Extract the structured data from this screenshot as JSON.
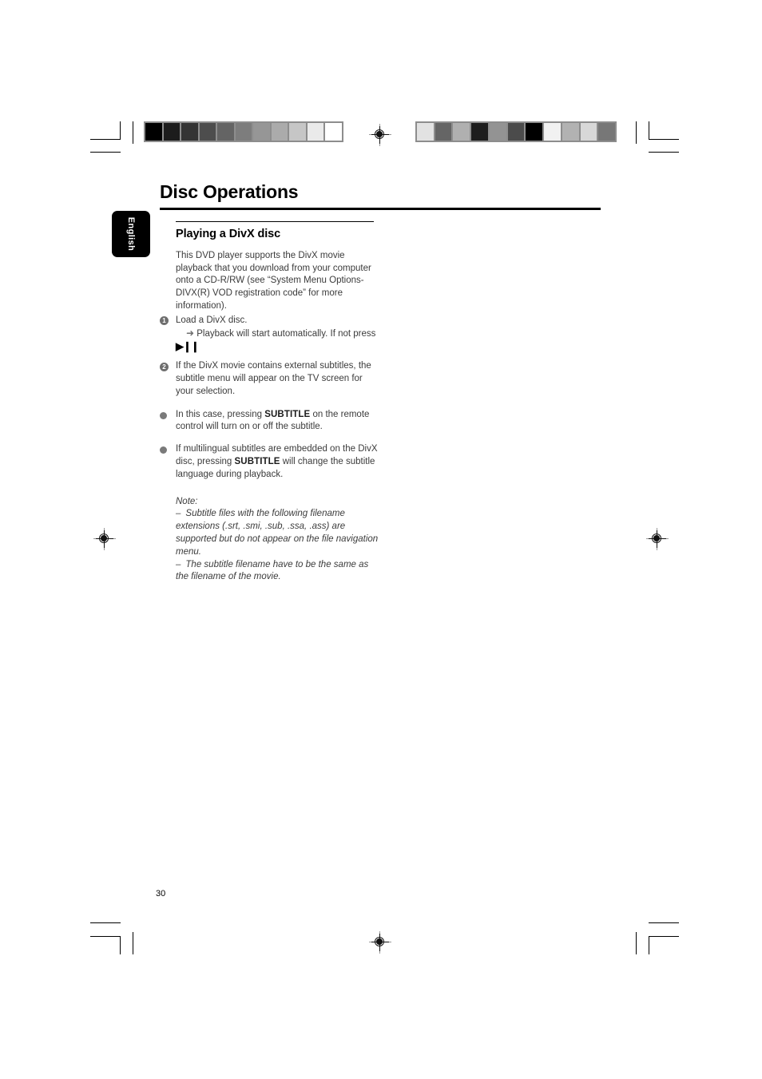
{
  "page": {
    "title": "Disc Operations",
    "folio": "30",
    "language_tab": "English"
  },
  "section": {
    "heading": "Playing a DivX disc",
    "intro": "This DVD player supports the DivX movie playback that you download from your computer onto a CD-R/RW (see “System Menu Options-DIVX(R) VOD registration code” for more information).",
    "steps": [
      {
        "number": "1",
        "text": "Load a DivX disc.",
        "sub_arrow": "➜",
        "sub_text": "Playback will start automatically. If not press",
        "transport_glyph": "▶❙❙"
      },
      {
        "number": "2",
        "text_before": "If the DivX movie contains external subtitles, the subtitle menu will appear on the TV screen for your selection."
      }
    ],
    "bullets": [
      {
        "before": "In this case, pressing ",
        "key": "SUBTITLE",
        "after": " on the remote control will turn on or off the subtitle."
      },
      {
        "before": "If multilingual subtitles are embedded on the DivX disc, pressing ",
        "key": "SUBTITLE",
        "after": " will change the subtitle language during playback."
      }
    ],
    "note": {
      "label": "Note:",
      "items": [
        "Subtitle files with the following filename extensions (.srt, .smi, .sub, .ssa, .ass) are supported but do not appear on the file navigation menu.",
        "The subtitle filename have to be the same as the filename of the movie."
      ],
      "dash": "–"
    }
  },
  "print_marks": {
    "colorbar_left": [
      "#000000",
      "#1c1c1c",
      "#343434",
      "#4d4d4d",
      "#646464",
      "#7d7d7d",
      "#969696",
      "#ababab",
      "#c6c6c6",
      "#eaeaea",
      "#ffffff"
    ],
    "colorbar_right": [
      "#e2e2e2",
      "#656565",
      "#b0b0b0",
      "#1d1d1d",
      "#939393",
      "#4b4b4b",
      "#000000",
      "#f1f1f1",
      "#b2b2b2",
      "#d8d8d8",
      "#777777"
    ]
  }
}
